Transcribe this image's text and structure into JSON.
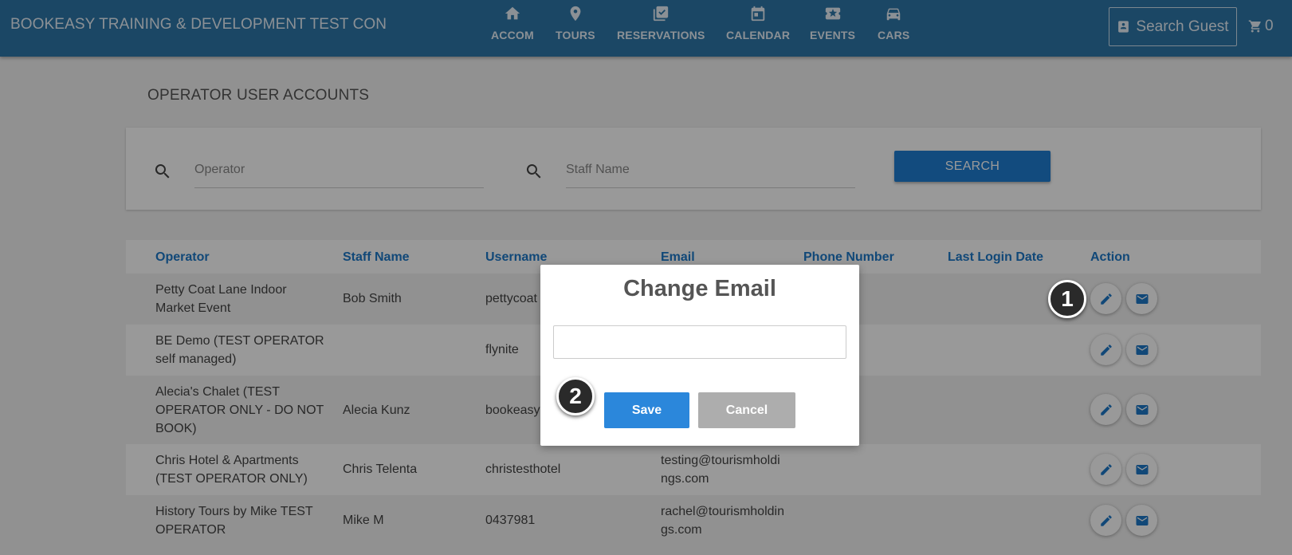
{
  "header": {
    "brand": "BOOKEASY TRAINING & DEVELOPMENT TEST CON",
    "nav": [
      {
        "label": "ACCOM",
        "icon": "home-icon"
      },
      {
        "label": "TOURS",
        "icon": "map-pin-icon"
      },
      {
        "label": "RESERVATIONS",
        "icon": "calendar-check-icon"
      },
      {
        "label": "CALENDAR",
        "icon": "calendar-icon"
      },
      {
        "label": "EVENTS",
        "icon": "ticket-icon"
      },
      {
        "label": "CARS",
        "icon": "car-icon"
      }
    ],
    "search_guest": "Search Guest",
    "cart_count": "0"
  },
  "page": {
    "title": "OPERATOR USER ACCOUNTS",
    "search": {
      "operator_placeholder": "Operator",
      "staff_placeholder": "Staff Name",
      "button": "SEARCH"
    }
  },
  "table": {
    "columns": [
      "Operator",
      "Staff Name",
      "Username",
      "Email",
      "Phone Number",
      "Last Login Date",
      "Action"
    ],
    "rows": [
      {
        "operator": [
          "Petty Coat Lane Indoor",
          "Market Event"
        ],
        "staff": "Bob Smith",
        "username": "pettycoat",
        "email": []
      },
      {
        "operator": [
          "BE Demo (TEST OPERATOR",
          "self managed)"
        ],
        "staff": "",
        "username": "flynite",
        "email": []
      },
      {
        "operator": [
          "Alecia's Chalet (TEST",
          "OPERATOR ONLY - DO NOT",
          "BOOK)"
        ],
        "staff": "Alecia Kunz",
        "username": "bookeasy",
        "email": []
      },
      {
        "operator": [
          "Chris Hotel & Apartments",
          "(TEST OPERATOR ONLY)"
        ],
        "staff": "Chris Telenta",
        "username": "christesthotel",
        "email": [
          "testing@tourismholdi",
          "ngs.com"
        ]
      },
      {
        "operator": [
          "History Tours by Mike TEST",
          "OPERATOR"
        ],
        "staff": "Mike M",
        "username": "0437981",
        "email": [
          "rachel@tourismholdin",
          "gs.com"
        ]
      }
    ]
  },
  "modal": {
    "title": "Change Email",
    "input_value": "",
    "save": "Save",
    "cancel": "Cancel"
  },
  "markers": [
    "1",
    "2"
  ]
}
